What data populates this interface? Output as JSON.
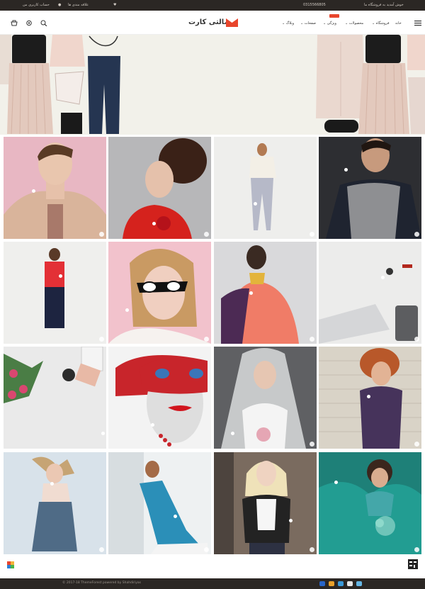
{
  "topbar": {
    "welcome": "خوش آمدید به فروشگاه ما",
    "phone": "0315566805",
    "wishlist": "علاقه مندی ها",
    "account": "حساب کاربری من"
  },
  "header": {
    "logo_text": "مالتی کارت",
    "nav": [
      {
        "label": "خانه"
      },
      {
        "label": "فروشگاه"
      },
      {
        "label": "محصولات"
      },
      {
        "label": "ویژگی",
        "badge": "جدید"
      },
      {
        "label": "صفحات"
      },
      {
        "label": "وبلاگ"
      }
    ],
    "icons": [
      "menu-icon",
      "search-icon",
      "gear-icon",
      "cart-icon"
    ]
  },
  "footer": {
    "copyright": "© 2017-18 ThemeForest powered by Shahdiriyas",
    "social_icons": [
      "social-icon",
      "social-icon",
      "social-icon",
      "social-icon",
      "social-icon"
    ],
    "payment_icons": [
      "visa-icon",
      "mastercard-icon",
      "paypal-icon",
      "discover-icon",
      "amex-icon"
    ]
  },
  "colors": {
    "accent": "#e8452c",
    "dark": "#2b2724",
    "banner_bg": "#f2f1ea"
  }
}
